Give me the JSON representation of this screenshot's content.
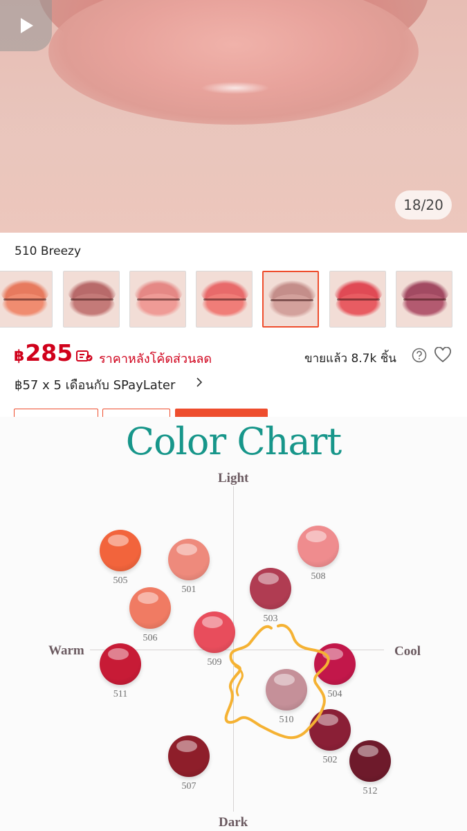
{
  "hero": {
    "counter": "18/20",
    "play_icon": "play-icon"
  },
  "variant": {
    "name": "510 Breezy",
    "swatches": [
      {
        "upper": "#e77a5e",
        "lower": "#f08c70"
      },
      {
        "upper": "#b86a6a",
        "lower": "#c47a78"
      },
      {
        "upper": "#e58885",
        "lower": "#ef9b96"
      },
      {
        "upper": "#e86a6a",
        "lower": "#f07d78"
      },
      {
        "upper": "#c48e8a",
        "lower": "#d3a19c",
        "selected": true
      },
      {
        "upper": "#e04a55",
        "lower": "#e85c62"
      },
      {
        "upper": "#a24a62",
        "lower": "#b35a70"
      }
    ]
  },
  "price": {
    "currency": "฿",
    "amount": "285",
    "after_code_label": "ราคาหลังโค้ดส่วนลด",
    "sold": "ขายแล้ว 8.7k ชิ้น",
    "installment": "฿57 x 5 เดือนกับ SPayLater"
  },
  "colors": {
    "accent": "#ee4d2d",
    "price_red": "#d0011b",
    "chart_title": "#17968a",
    "scribble": "#f5b233"
  },
  "color_chart": {
    "title": "Color Chart",
    "axis": {
      "top": "Light",
      "bottom": "Dark",
      "left": "Warm",
      "right": "Cool"
    },
    "shades": [
      {
        "code": "505",
        "color": "#f2643c"
      },
      {
        "code": "501",
        "color": "#ee8a7c"
      },
      {
        "code": "508",
        "color": "#ef8c8e"
      },
      {
        "code": "503",
        "color": "#b03c52"
      },
      {
        "code": "506",
        "color": "#f07b63"
      },
      {
        "code": "509",
        "color": "#e84d5c"
      },
      {
        "code": "511",
        "color": "#c71b36"
      },
      {
        "code": "504",
        "color": "#c2174a"
      },
      {
        "code": "510",
        "color": "#c59099"
      },
      {
        "code": "502",
        "color": "#8a1f36"
      },
      {
        "code": "507",
        "color": "#8e1e2a"
      },
      {
        "code": "512",
        "color": "#6e1a2b"
      }
    ]
  }
}
